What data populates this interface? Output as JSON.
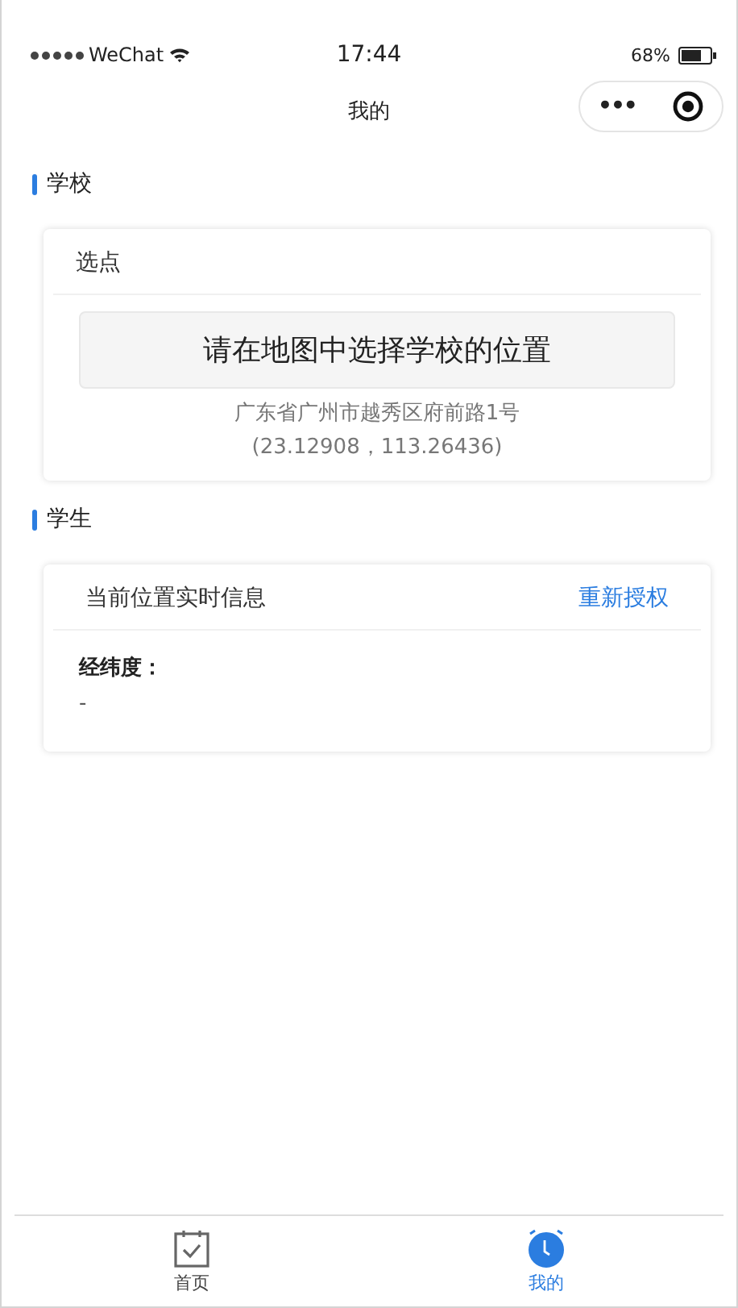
{
  "status_bar": {
    "carrier": "WeChat",
    "time": "17:44",
    "battery": "68%"
  },
  "nav": {
    "title": "我的",
    "menu_icon": "•••"
  },
  "school": {
    "heading": "学校",
    "card_title": "选点",
    "button": "请在地图中选择学校的位置",
    "address": "广东省广州市越秀区府前路1号",
    "coords": "(23.12908，113.26436)"
  },
  "student": {
    "heading": "学生",
    "card_title": "当前位置实时信息",
    "action": "重新授权",
    "field_label": "经纬度：",
    "field_value": "-"
  },
  "tabs": [
    {
      "label": "首页",
      "kind": "clipboard",
      "selected": false
    },
    {
      "label": "我的",
      "kind": "clock",
      "selected": true
    }
  ]
}
